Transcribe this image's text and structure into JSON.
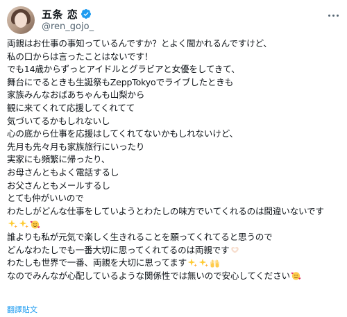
{
  "author": {
    "display_name": "五条 恋",
    "handle": "@ren_gojo_",
    "verified": true
  },
  "tweet": {
    "lines": [
      "両親はお仕事の事知っているんですか？とよく聞かれるんですけど、",
      "私の口からは言ったことはないです！",
      "でも14歳からずっとアイドルとグラビアと女優をしてきて、",
      "舞台にでるときも生誕祭もZeppTokyoでライブしたときも",
      "家族みんなおばあちゃんも山梨から",
      "観に来てくれて応援してくれてて",
      "気づいてるかもしれないし",
      "心の底から仕事を応援はしてくれてないかもしれないけど、",
      "先月も先々月も家族旅行にいったり",
      "実家にも頻繁に帰ったり、",
      "お母さんともよく電話するし",
      "お父さんともメールするし",
      "とても仲がいいので",
      "わたしがどんな仕事をしていようとわたしの味方でいてくれるのは間違いないです",
      "",
      "誰よりも私が元気で楽しく生きれることを願ってくれてると思うので",
      "どんなわたしでも一番大切に思ってくれてるのは両親です",
      "わたしも世界で一番、両親を大切に思ってます",
      "なのでみんなが心配しているような関係性では無いので安心してください"
    ],
    "emojis": {
      "line14": [
        "sparkles-icon",
        "sparkles-icon",
        "smiling-face-with-hearts-icon"
      ],
      "line16": [
        "heart-hands-icon"
      ],
      "line17": [
        "sparkles-icon",
        "sparkles-icon",
        "raising-hands-icon"
      ],
      "line18": [
        "smiling-face-with-hearts-icon"
      ]
    }
  },
  "actions": {
    "translate_label": "翻譯貼文"
  },
  "colors": {
    "link": "#1d9bf0",
    "secondary_text": "#536471",
    "verified_badge": "#1d9bf0"
  }
}
